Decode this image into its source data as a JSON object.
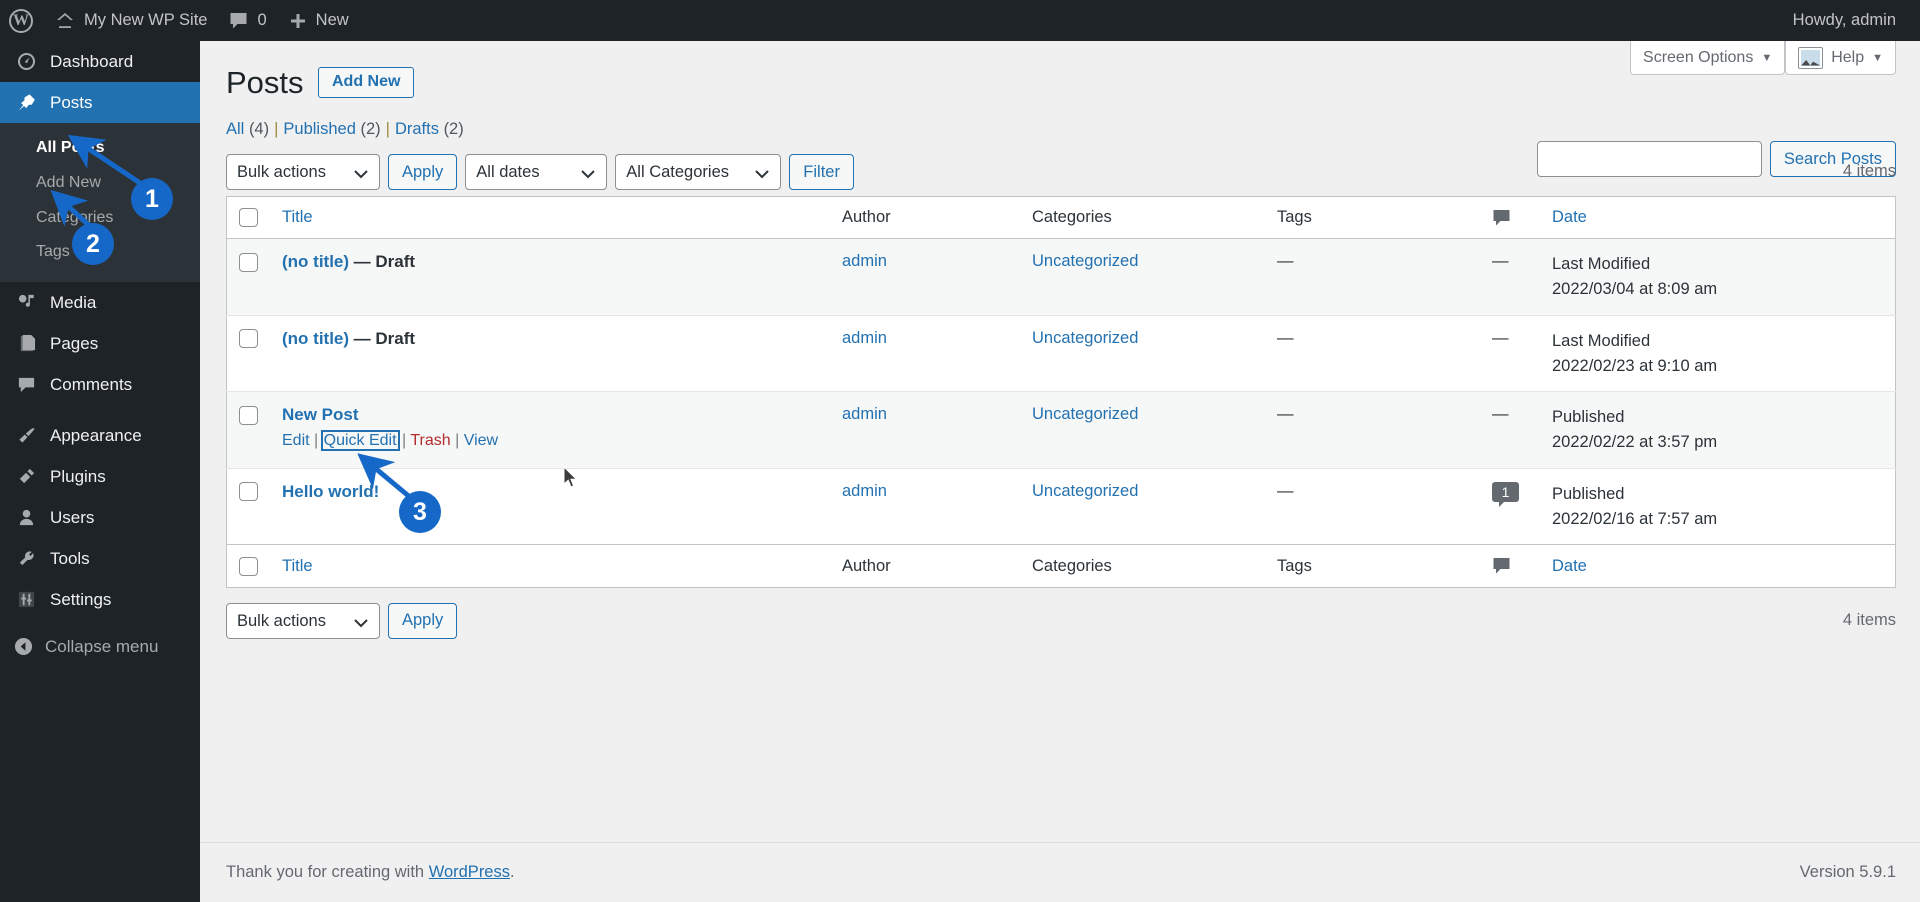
{
  "adminbar": {
    "logo_icon": "wordpress-logo-icon",
    "site_icon": "home-icon",
    "site_name": "My New WP Site",
    "comments_icon": "comment-bubble-icon",
    "comments_count": "0",
    "new_icon": "plus-icon",
    "new_label": "New",
    "howdy": "Howdy, admin"
  },
  "sidebar": {
    "items": [
      {
        "label": "Dashboard",
        "icon": "dashboard-icon"
      },
      {
        "label": "Posts",
        "icon": "pin-icon"
      },
      {
        "label": "Media",
        "icon": "media-icon"
      },
      {
        "label": "Pages",
        "icon": "pages-icon"
      },
      {
        "label": "Comments",
        "icon": "comment-icon"
      },
      {
        "label": "Appearance",
        "icon": "paintbrush-icon"
      },
      {
        "label": "Plugins",
        "icon": "plug-icon"
      },
      {
        "label": "Users",
        "icon": "user-icon"
      },
      {
        "label": "Tools",
        "icon": "wrench-icon"
      },
      {
        "label": "Settings",
        "icon": "sliders-icon"
      }
    ],
    "submenu": [
      {
        "label": "All Posts"
      },
      {
        "label": "Add New"
      },
      {
        "label": "Categories"
      },
      {
        "label": "Tags"
      }
    ],
    "collapse": {
      "label": "Collapse menu",
      "icon": "collapse-arrow-icon"
    }
  },
  "screen_meta": {
    "screen_options": "Screen Options",
    "help": "Help",
    "caret": "▼",
    "image_icon": "image-icon"
  },
  "header": {
    "title": "Posts",
    "add_new": "Add New"
  },
  "views": {
    "all_label": "All",
    "all_count": "(4)",
    "published_label": "Published",
    "published_count": "(2)",
    "drafts_label": "Drafts",
    "drafts_count": "(2)",
    "separator": "|"
  },
  "search": {
    "value": "",
    "placeholder": "",
    "button": "Search Posts"
  },
  "tablenav_top": {
    "bulk_actions": "Bulk actions",
    "apply": "Apply",
    "all_dates": "All dates",
    "all_categories": "All Categories",
    "filter": "Filter",
    "items_count": "4 items"
  },
  "tablenav_bottom": {
    "bulk_actions": "Bulk actions",
    "apply": "Apply",
    "items_count": "4 items"
  },
  "table": {
    "columns": {
      "title": "Title",
      "author": "Author",
      "categories": "Categories",
      "tags": "Tags",
      "comments": "comment-bubble-icon",
      "date": "Date"
    },
    "rows": [
      {
        "title": "(no title)",
        "state": "— Draft",
        "author": "admin",
        "categories": "Uncategorized",
        "tags": "—",
        "comments": "—",
        "date_status": "Last Modified",
        "date_value": "2022/03/04 at 8:09 am",
        "actions_visible": false
      },
      {
        "title": "(no title)",
        "state": "— Draft",
        "author": "admin",
        "categories": "Uncategorized",
        "tags": "—",
        "comments": "—",
        "date_status": "Last Modified",
        "date_value": "2022/02/23 at 9:10 am",
        "actions_visible": false
      },
      {
        "title": "New Post",
        "state": "",
        "author": "admin",
        "categories": "Uncategorized",
        "tags": "—",
        "comments": "—",
        "date_status": "Published",
        "date_value": "2022/02/22 at 3:57 pm",
        "actions_visible": true
      },
      {
        "title": "Hello world!",
        "state": "",
        "author": "admin",
        "categories": "Uncategorized",
        "tags": "—",
        "comments": "1",
        "date_status": "Published",
        "date_value": "2022/02/16 at 7:57 am",
        "actions_visible": false
      }
    ],
    "row_actions": {
      "edit": "Edit",
      "quick_edit": "Quick Edit",
      "trash": "Trash",
      "view": "View",
      "sep": "|"
    }
  },
  "footer": {
    "thanks_prefix": "Thank you for creating with ",
    "wordpress": "WordPress",
    "thanks_suffix": ".",
    "version": "Version 5.9.1"
  },
  "annotations": {
    "badge1": "1",
    "badge2": "2",
    "badge3": "3",
    "color": "#1668c8"
  }
}
